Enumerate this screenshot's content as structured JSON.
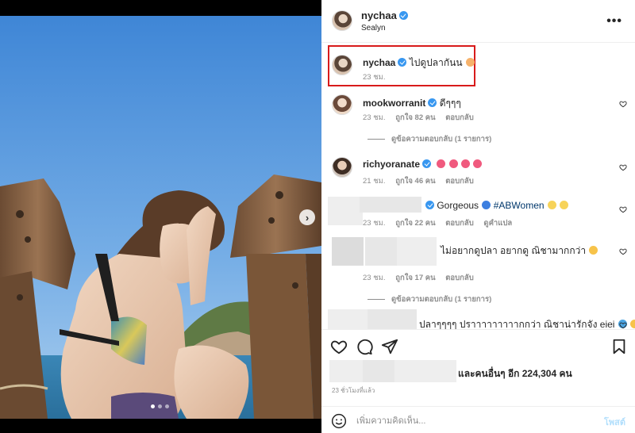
{
  "post": {
    "author": "nychaa",
    "subtitle": "Sealyn",
    "more_label": "•••",
    "image": {
      "description_icon": "photo",
      "next_label": "›",
      "dots": 3,
      "active_dot": 0
    }
  },
  "caption": {
    "username": "nychaa",
    "text": "ไปดูปลากันน",
    "time": "23 ชม."
  },
  "comments": [
    {
      "username": "mookworranit",
      "verified": true,
      "text": "ดีๆๆๆ",
      "time": "23 ชม.",
      "likes": "ถูกใจ 82 คน",
      "reply": "ตอบกลับ",
      "view_replies": "ดูข้อความตอบกลับ (1 รายการ)"
    },
    {
      "username": "richyoranate",
      "verified": true,
      "text": "",
      "time": "21 ชม.",
      "likes": "ถูกใจ 46 คน",
      "reply": "ตอบกลับ"
    },
    {
      "username": "",
      "verified": true,
      "text": "Gorgeous",
      "hashtag": "#ABWomen",
      "time": "23 ชม.",
      "likes": "ถูกใจ 22 คน",
      "reply": "ตอบกลับ",
      "translate": "ดูคำแปล"
    },
    {
      "username": "",
      "verified": false,
      "text": "ไม่อยากดูปลา อยากดู ณิชามากกว่า",
      "time": "23 ชม.",
      "likes": "ถูกใจ 17 คน",
      "reply": "ตอบกลับ",
      "view_replies": "ดูข้อความตอบกลับ (1 รายการ)"
    },
    {
      "username": "",
      "verified": false,
      "text": "ปลาๆๆๆๆ ปราาาาาาาาากกว่า ณิชาน่ารักจัง eiei"
    }
  ],
  "footer": {
    "likes_text": "และคนอื่นๆ อีก 224,304 คน",
    "time_ago": "23 ชั่วโมงที่แล้ว",
    "comment_placeholder": "เพิ่มความคิดเห็น...",
    "post_label": "โพสต์"
  },
  "colors": {
    "verified": "#3897f0",
    "highlight_box": "#d81b1b",
    "post_button": "#b2dffc",
    "muted_text": "#8e8e8e"
  },
  "icons": {
    "like": "heart-icon",
    "comment": "comment-icon",
    "share": "paper-plane-icon",
    "save": "bookmark-icon",
    "emoji": "smiley-icon",
    "more": "ellipsis-icon"
  }
}
